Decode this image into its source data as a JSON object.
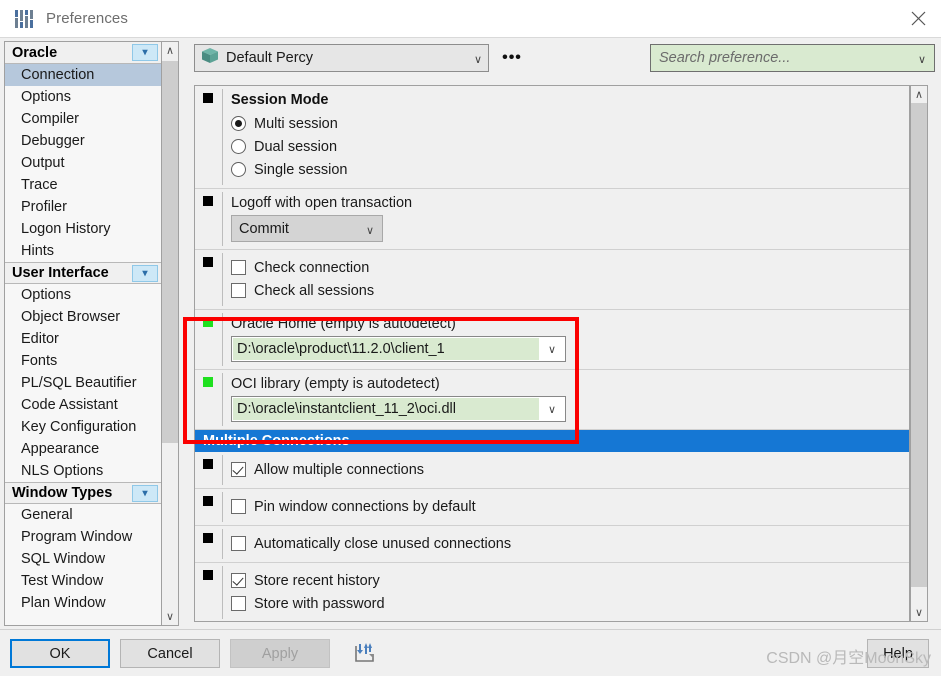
{
  "window": {
    "title": "Preferences",
    "icon": "sliders-icon",
    "close_label": "×"
  },
  "sidebar": {
    "scroll": {
      "up": "∧",
      "down": "∨"
    },
    "groups": [
      {
        "label": "Oracle",
        "expander": "▾",
        "items": [
          {
            "label": "Connection",
            "selected": true
          },
          {
            "label": "Options",
            "selected": false
          },
          {
            "label": "Compiler",
            "selected": false
          },
          {
            "label": "Debugger",
            "selected": false
          },
          {
            "label": "Output",
            "selected": false
          },
          {
            "label": "Trace",
            "selected": false
          },
          {
            "label": "Profiler",
            "selected": false
          },
          {
            "label": "Logon History",
            "selected": false
          },
          {
            "label": "Hints",
            "selected": false
          }
        ]
      },
      {
        "label": "User Interface",
        "expander": "▾",
        "items": [
          {
            "label": "Options",
            "selected": false
          },
          {
            "label": "Object Browser",
            "selected": false
          },
          {
            "label": "Editor",
            "selected": false
          },
          {
            "label": "Fonts",
            "selected": false
          },
          {
            "label": "PL/SQL Beautifier",
            "selected": false
          },
          {
            "label": "Code Assistant",
            "selected": false
          },
          {
            "label": "Key Configuration",
            "selected": false
          },
          {
            "label": "Appearance",
            "selected": false
          },
          {
            "label": "NLS Options",
            "selected": false
          }
        ]
      },
      {
        "label": "Window Types",
        "expander": "▾",
        "items": [
          {
            "label": "General",
            "selected": false
          },
          {
            "label": "Program Window",
            "selected": false
          },
          {
            "label": "SQL Window",
            "selected": false
          },
          {
            "label": "Test Window",
            "selected": false
          },
          {
            "label": "Plan Window",
            "selected": false
          }
        ]
      }
    ]
  },
  "toolbar": {
    "profile": {
      "icon": "package-icon",
      "value": "Default Percy",
      "chevron": "∨"
    },
    "more_button": "•••",
    "search": {
      "placeholder": "Search preference...",
      "value": "",
      "chevron": "∨"
    }
  },
  "content": {
    "session_mode": {
      "title": "Session Mode",
      "options": [
        {
          "label": "Multi session",
          "checked": true
        },
        {
          "label": "Dual session",
          "checked": false
        },
        {
          "label": "Single session",
          "checked": false
        }
      ]
    },
    "logoff": {
      "label": "Logoff with open transaction",
      "value": "Commit",
      "chevron": "∨"
    },
    "checks": [
      {
        "label": "Check connection",
        "checked": false
      },
      {
        "label": "Check all sessions",
        "checked": false
      }
    ],
    "oracle_home": {
      "label": "Oracle Home (empty is autodetect)",
      "value": "D:\\oracle\\product\\11.2.0\\client_1",
      "chevron": "∨",
      "marker_color": "#1fe01f"
    },
    "oci_library": {
      "label": "OCI library (empty is autodetect)",
      "value": "D:\\oracle\\instantclient_11_2\\oci.dll",
      "chevron": "∨",
      "marker_color": "#1fe01f"
    },
    "multiple_connections": {
      "header": "Multiple Connections",
      "header_color": "#1577d4",
      "items": [
        {
          "label": "Allow multiple connections",
          "checked": true
        },
        {
          "label": "Pin window connections by default",
          "checked": false
        },
        {
          "label": "Automatically close unused connections",
          "checked": false
        },
        {
          "label": "Store recent history",
          "checked": true
        },
        {
          "label": "Store with password",
          "checked": false
        }
      ]
    },
    "scroll": {
      "up": "∧",
      "down": "∨"
    }
  },
  "highlight": {
    "color": "#fb0000"
  },
  "footer": {
    "ok": "OK",
    "cancel": "Cancel",
    "apply": "Apply",
    "help": "Help",
    "import_export_icon": "import-export-icon"
  },
  "watermark": "CSDN @月空MoonSky"
}
